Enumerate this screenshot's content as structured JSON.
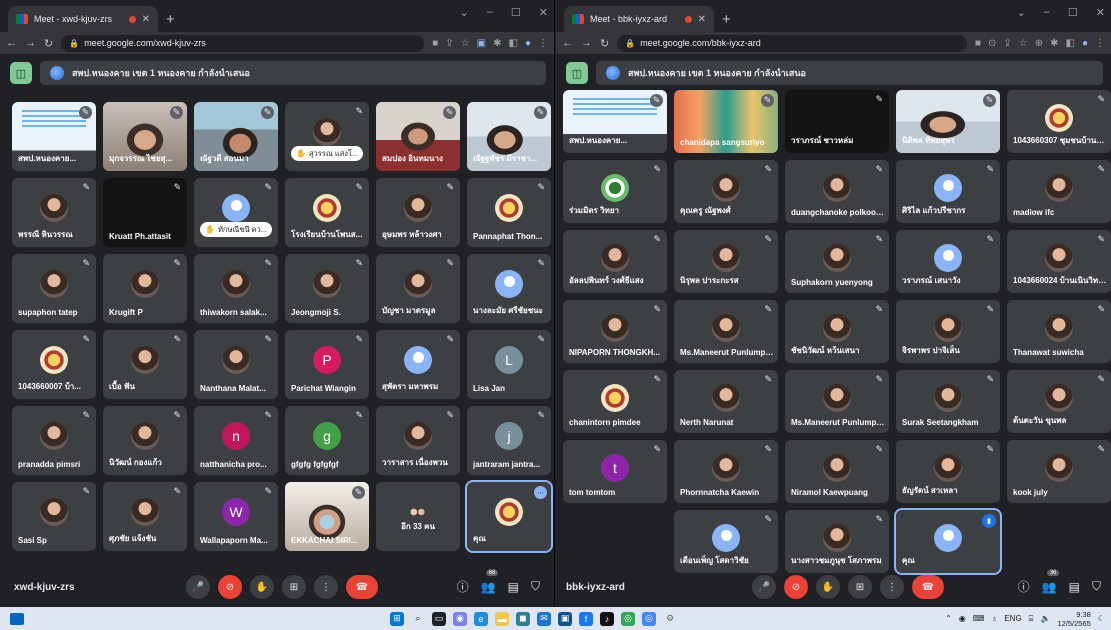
{
  "left_window": {
    "tab_title": "Meet - xwd-kjuv-zrs",
    "url": "meet.google.com/xwd-kjuv-zrs",
    "presentation_title": "สพป.หนองคาย เขต 1 หนองคาย กำลังนำเสนอ",
    "meeting_code": "xwd-kjuv-zrs",
    "people_count": "68",
    "tiles": [
      {
        "name": "สพป.หนองคาย...",
        "video": "v-slide"
      },
      {
        "name": "มุกจวรรณ ไชยสุ...",
        "video": "v-face"
      },
      {
        "name": "ณัฐวดี สอนมา",
        "video": "v-room"
      },
      {
        "name": "",
        "avatar": "photo",
        "chip": "สุวรรณ แสงโ..."
      },
      {
        "name": "สมปอง อินทมนาง",
        "video": "v-scarf"
      },
      {
        "name": "ณัฐฐพัชร มีราชา...",
        "video": "v-office"
      },
      {
        "name": "พรรณี หินวรรณ",
        "avatar": "photo"
      },
      {
        "name": "Kruatt Ph.attasit",
        "dark": true
      },
      {
        "name": "",
        "avatar": "person",
        "chip": "ทักษณีชนี ดว..."
      },
      {
        "name": "โรงเรียนบ้านโพนส...",
        "avatar": "logo"
      },
      {
        "name": "อุษมพร หล้าวงศา",
        "avatar": "photo"
      },
      {
        "name": "Pannaphat Thon...",
        "avatar": "logo"
      },
      {
        "name": "supaphon tatep",
        "avatar": "photo"
      },
      {
        "name": "Krugift P",
        "avatar": "photo"
      },
      {
        "name": "thiwakorn salak...",
        "avatar": "photo"
      },
      {
        "name": "Jeongmoji S.",
        "avatar": "photo"
      },
      {
        "name": "บัญชา มาตรมูล",
        "avatar": "photo"
      },
      {
        "name": "นางละมัย ศรีชัยชนะ",
        "avatar": "person"
      },
      {
        "name": "1043660007 บ้า...",
        "avatar": "logo"
      },
      {
        "name": "เบื้อ ฟัน",
        "avatar": "photo"
      },
      {
        "name": "Nanthana Malat...",
        "avatar": "photo"
      },
      {
        "name": "Parichat Wiangin",
        "letter": "P",
        "color": "#d81b60"
      },
      {
        "name": "สุพัตรา มหาพรม",
        "avatar": "person"
      },
      {
        "name": "Lisa Jan",
        "letter": "L",
        "color": "#78909c"
      },
      {
        "name": "pranadda pimsri",
        "avatar": "photo"
      },
      {
        "name": "นิวัฒน์ กองแก้ว",
        "avatar": "photo"
      },
      {
        "name": "natthanicha pro...",
        "letter": "n",
        "color": "#c2185b"
      },
      {
        "name": "gfgfg fgfgfgf",
        "letter": "g",
        "color": "#43a047"
      },
      {
        "name": "วาราสาร เนื่องพวน",
        "avatar": "photo"
      },
      {
        "name": "jantraram jantra...",
        "letter": "j",
        "color": "#78909c"
      },
      {
        "name": "Sasi Sp",
        "avatar": "photo"
      },
      {
        "name": "ศุภชัย แจ้งชัน",
        "avatar": "photo"
      },
      {
        "name": "Wallapaporn Ma...",
        "letter": "W",
        "color": "#8e24aa"
      },
      {
        "name": "EKKACHAI SIRI...",
        "video": "v-mask"
      },
      {
        "name": "อีก 33 คน",
        "avatar": "others"
      },
      {
        "name": "คุณ",
        "avatar": "logo",
        "self": true
      }
    ]
  },
  "right_window": {
    "tab_title": "Meet - bbk-iyxz-ard",
    "url": "meet.google.com/bbk-iyxz-ard",
    "presentation_title": "สพป.หนองคาย เขต 1 หนองคาย กำลังนำเสนอ",
    "meeting_code": "bbk-iyxz-ard",
    "people_count": "36",
    "tiles": [
      {
        "name": "สพป.หนองคาย...",
        "video": "v-slide"
      },
      {
        "name": "chanidapa sangsuriyo",
        "video": "v-colorful"
      },
      {
        "name": "วราภรณ์ ชาวหล่ม",
        "dark": true
      },
      {
        "name": "นิติพล ทิพยสุพร",
        "video": "v-office"
      },
      {
        "name": "1043660307 ชุมชนบ้านหม้อ",
        "avatar": "logo"
      },
      {
        "name": "ร่วมมิตร วิทยา",
        "avatar": "green"
      },
      {
        "name": "คุณครู ณัฐพงศ์",
        "avatar": "photo"
      },
      {
        "name": "duangchanoke polkoom...",
        "avatar": "photo"
      },
      {
        "name": "ศิริไล แก้วปรีชากร",
        "avatar": "person"
      },
      {
        "name": "madiow ifc",
        "avatar": "photo"
      },
      {
        "name": "อัลลปพินทร์ วงศ์ธีแสง",
        "avatar": "photo"
      },
      {
        "name": "นิรุพล ปาระกะรส",
        "avatar": "photo"
      },
      {
        "name": "Suphakorn yuenyong",
        "avatar": "photo"
      },
      {
        "name": "วราภรณ์ เสนาวัง",
        "avatar": "person"
      },
      {
        "name": "1043660024 บ้านเนินวิทยา",
        "avatar": "photo"
      },
      {
        "name": "NIPAPORN THONGKH...",
        "avatar": "photo"
      },
      {
        "name": "Ms.Maneerut Punlumpuk",
        "avatar": "photo"
      },
      {
        "name": "ชัชนิวัฒน์ หว้นเสนา",
        "avatar": "photo"
      },
      {
        "name": "จิรพาพร ปาจิเส็น",
        "avatar": "photo"
      },
      {
        "name": "Thanawat suwicha",
        "avatar": "photo"
      },
      {
        "name": "chanintorn pimdee",
        "avatar": "logo"
      },
      {
        "name": "Nerth Narunat",
        "avatar": "photo"
      },
      {
        "name": "Ms.Maneerut Punlumpuk",
        "avatar": "photo"
      },
      {
        "name": "Surak Seetangkham",
        "avatar": "photo"
      },
      {
        "name": "ต้นตะวัน ขุนพล",
        "avatar": "photo"
      },
      {
        "name": "tom tomtom",
        "letter": "t",
        "color": "#8e24aa"
      },
      {
        "name": "Phornnatcha Kaewin",
        "avatar": "photo"
      },
      {
        "name": "Niramol Kaewpuang",
        "avatar": "photo"
      },
      {
        "name": "ธัญรัตน์ สาเหลา",
        "avatar": "photo"
      },
      {
        "name": "kook july",
        "avatar": "photo"
      },
      {
        "empty": true
      },
      {
        "name": "เดือนเพ็ญ โสดาวิชัย",
        "avatar": "person"
      },
      {
        "name": "นางสาวชมภูนุช โสภาพรม",
        "avatar": "photo"
      },
      {
        "name": "คุณ",
        "avatar": "person",
        "self": true
      }
    ]
  },
  "taskbar": {
    "language": "ENG",
    "time": "9:38",
    "date": "12/5/2565"
  },
  "colors": {
    "meet_bg": "#202124",
    "tile_bg": "#3c4043",
    "end_call": "#ea4335",
    "accent": "#8ab4f8"
  }
}
